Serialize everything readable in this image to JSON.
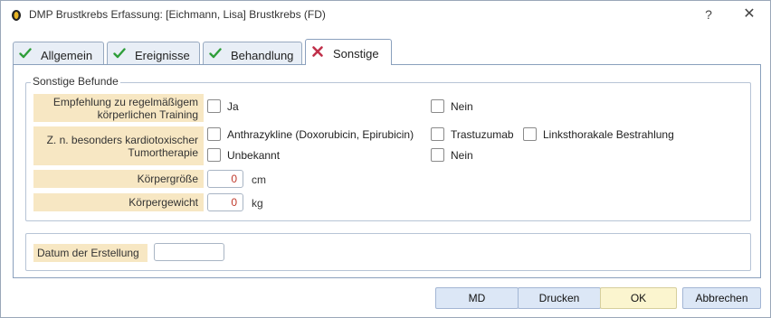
{
  "window": {
    "title": "DMP Brustkrebs Erfassung: [Eichmann, Lisa] Brustkrebs (FD)",
    "help": "?",
    "close": "✕"
  },
  "tabs": [
    {
      "label": "Allgemein",
      "icon": "check-icon",
      "active": false
    },
    {
      "label": "Ereignisse",
      "icon": "check-icon",
      "active": false
    },
    {
      "label": "Behandlung",
      "icon": "check-icon",
      "active": false
    },
    {
      "label": "Sonstige",
      "icon": "cross-icon",
      "active": true
    }
  ],
  "sonstige_befunde": {
    "title": "Sonstige Befunde",
    "training": {
      "label_line1": "Empfehlung zu regelmäßigem",
      "label_line2": "körperlichen Training",
      "options": [
        "Ja",
        "Nein"
      ]
    },
    "kardio": {
      "label_line1": "Z. n. besonders kardiotoxischer",
      "label_line2": "Tumortherapie",
      "options": [
        "Anthrazykline (Doxorubicin, Epirubicin)",
        "Trastuzumab",
        "Linksthorakale Bestrahlung",
        "Unbekannt",
        "Nein"
      ]
    },
    "groesse": {
      "label": "Körpergröße",
      "value": "0",
      "unit": "cm"
    },
    "gewicht": {
      "label": "Körpergewicht",
      "value": "0",
      "unit": "kg"
    }
  },
  "datum": {
    "label": "Datum der Erstellung",
    "value": ""
  },
  "buttons": {
    "md": "MD",
    "drucken": "Drucken",
    "ok": "OK",
    "abbrechen": "Abbrechen"
  },
  "colors": {
    "check": "#2e9e3a",
    "cross": "#c0304a",
    "label_bg": "#f7e7c3",
    "value_red": "#c0392b"
  }
}
